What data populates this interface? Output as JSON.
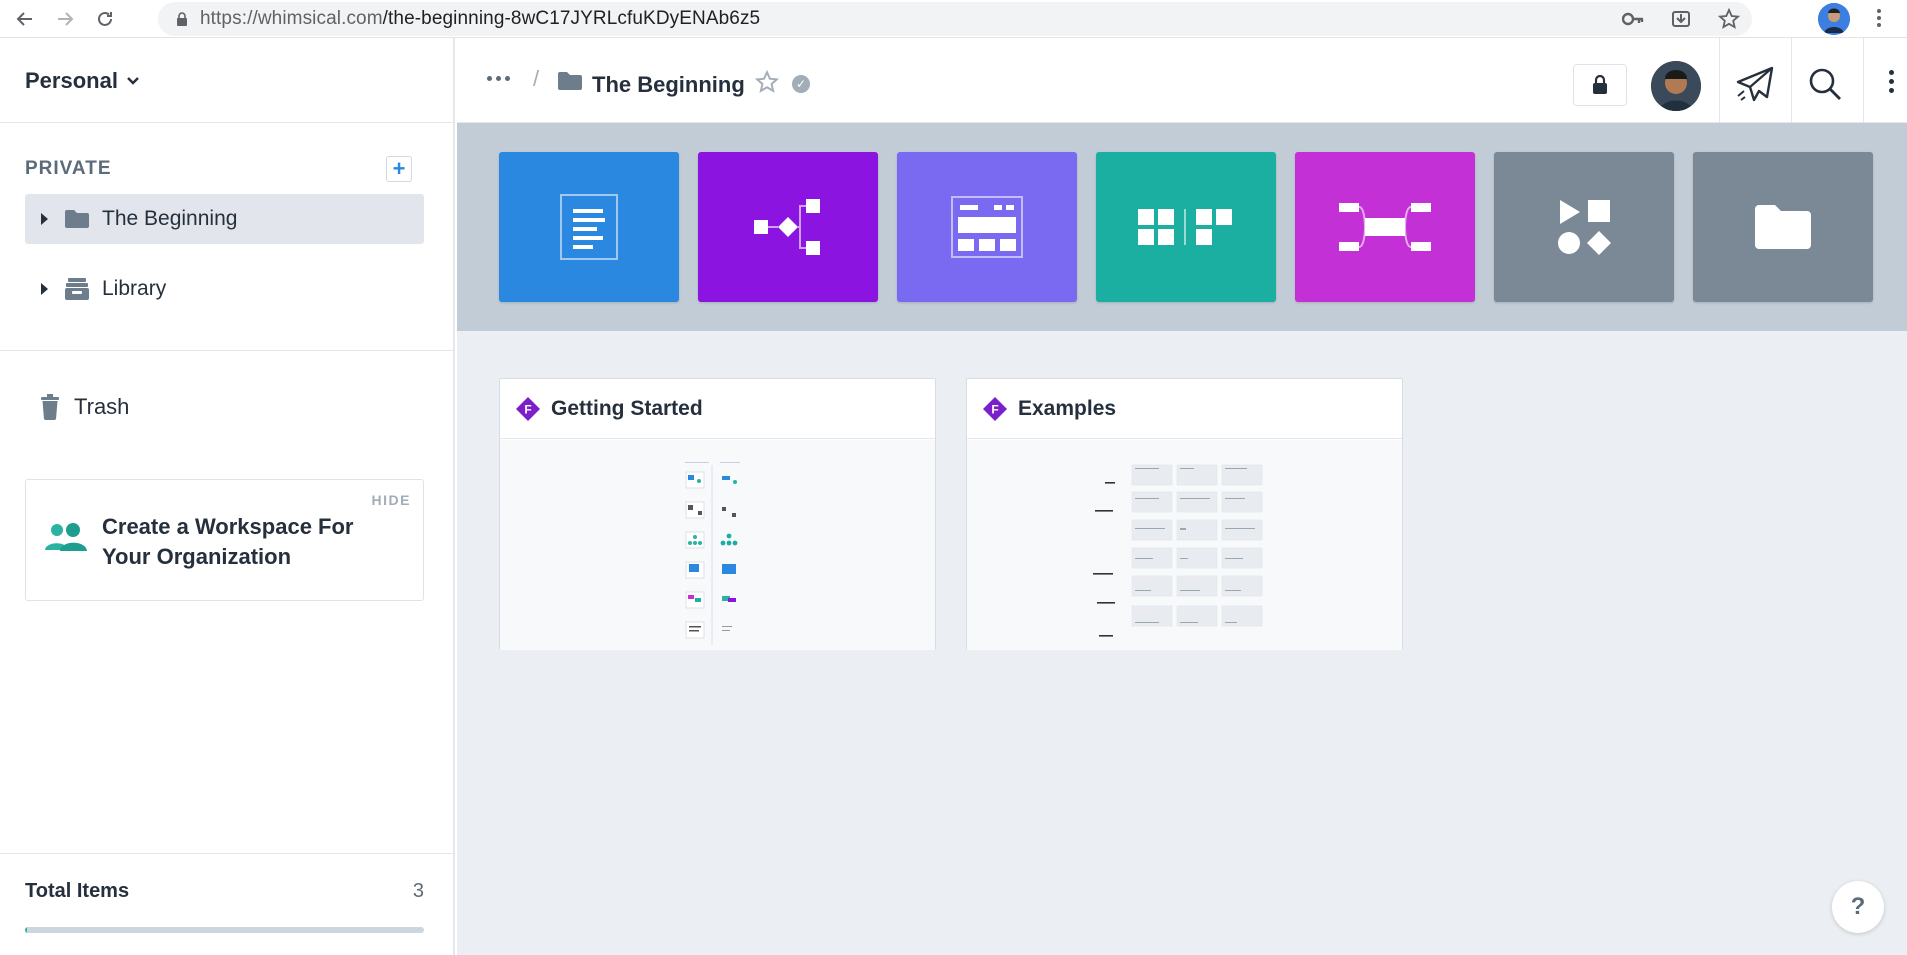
{
  "browser": {
    "url_host": "https://whimsical.com",
    "url_path": "/the-beginning-8wC17JYRLcfuKDyENAb6z5"
  },
  "sidebar": {
    "workspace": "Personal",
    "section_label": "PRIVATE",
    "items": [
      {
        "label": "The Beginning",
        "icon": "folder-icon",
        "active": true
      },
      {
        "label": "Library",
        "icon": "library-icon",
        "active": false
      }
    ],
    "trash_label": "Trash",
    "promo": {
      "hide_label": "HIDE",
      "text": "Create a Workspace For Your Organization"
    },
    "total_label": "Total Items",
    "total_count": "3",
    "usage_fraction": 0.005
  },
  "header": {
    "folder_title": "The Beginning"
  },
  "create_tiles": [
    {
      "name": "doc",
      "color": "#2b88e0",
      "icon": "document-icon"
    },
    {
      "name": "flowchart",
      "color": "#8b14e0",
      "icon": "flowchart-icon"
    },
    {
      "name": "wireframe",
      "color": "#7a6af2",
      "icon": "wireframe-icon"
    },
    {
      "name": "sticky-notes",
      "color": "#1aafa0",
      "icon": "sticky-notes-icon"
    },
    {
      "name": "mind-map",
      "color": "#c230d6",
      "icon": "mind-map-icon"
    },
    {
      "name": "project",
      "color": "#7b8997",
      "icon": "shapes-icon"
    },
    {
      "name": "folder",
      "color": "#7b8997",
      "icon": "folder-icon"
    }
  ],
  "files": [
    {
      "title": "Getting Started",
      "badge": "F"
    },
    {
      "title": "Examples",
      "badge": "F"
    }
  ],
  "help_label": "?"
}
